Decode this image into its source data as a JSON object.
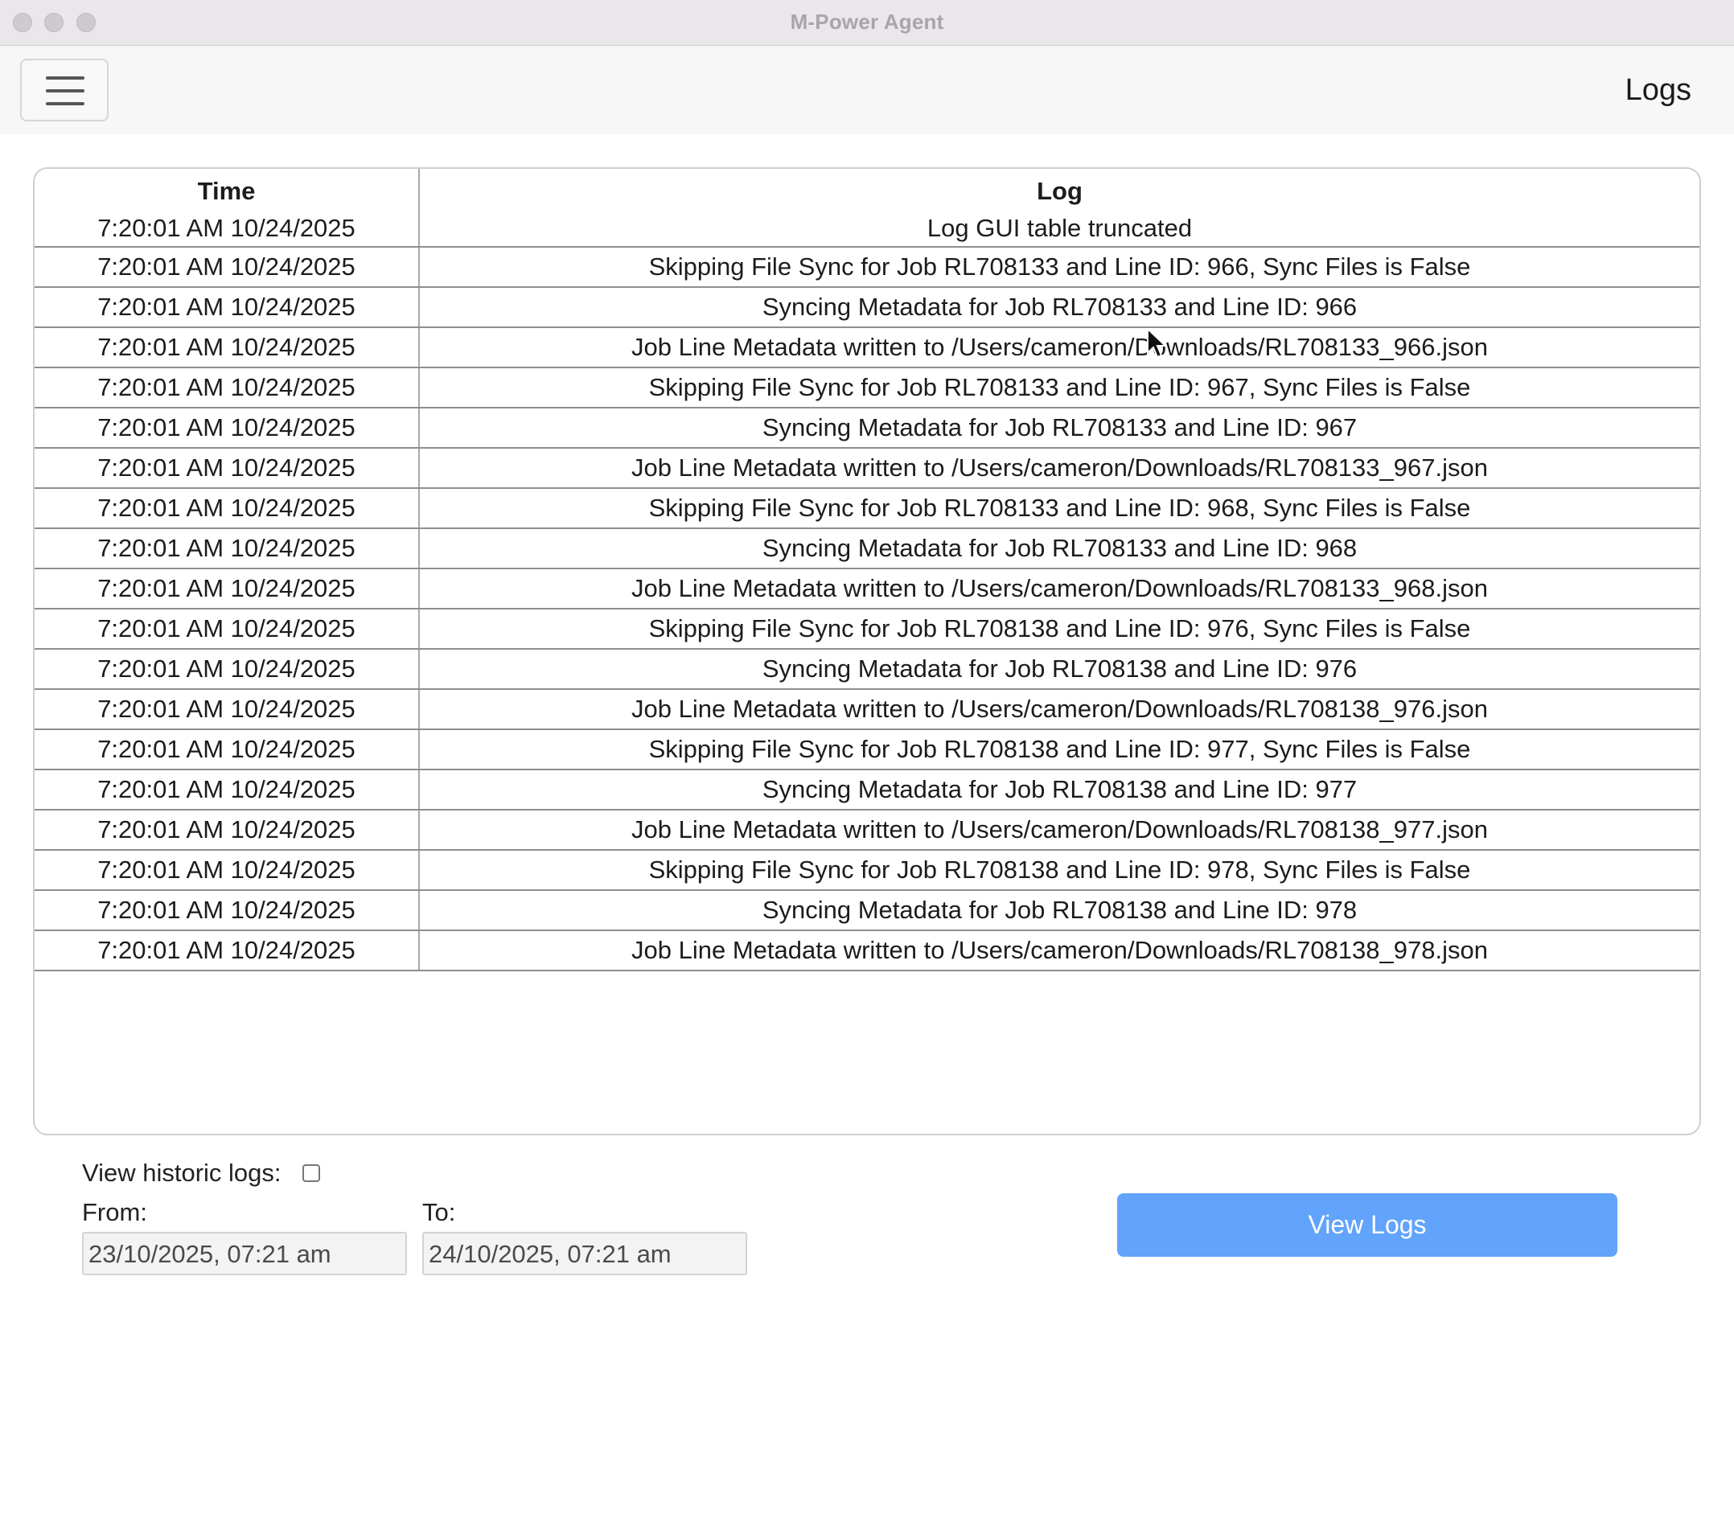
{
  "window": {
    "title": "M-Power Agent"
  },
  "header": {
    "page_title": "Logs"
  },
  "table": {
    "columns": [
      "Time",
      "Log"
    ],
    "rows": [
      {
        "time": "7:20:01 AM 10/24/2025",
        "log": "Log GUI table truncated"
      },
      {
        "time": "7:20:01 AM 10/24/2025",
        "log": "Skipping File Sync for Job RL708133 and Line ID: 966, Sync Files is False"
      },
      {
        "time": "7:20:01 AM 10/24/2025",
        "log": "Syncing Metadata for Job RL708133 and Line ID: 966"
      },
      {
        "time": "7:20:01 AM 10/24/2025",
        "log": "Job Line Metadata written to /Users/cameron/Downloads/RL708133_966.json"
      },
      {
        "time": "7:20:01 AM 10/24/2025",
        "log": "Skipping File Sync for Job RL708133 and Line ID: 967, Sync Files is False"
      },
      {
        "time": "7:20:01 AM 10/24/2025",
        "log": "Syncing Metadata for Job RL708133 and Line ID: 967"
      },
      {
        "time": "7:20:01 AM 10/24/2025",
        "log": "Job Line Metadata written to /Users/cameron/Downloads/RL708133_967.json"
      },
      {
        "time": "7:20:01 AM 10/24/2025",
        "log": "Skipping File Sync for Job RL708133 and Line ID: 968, Sync Files is False"
      },
      {
        "time": "7:20:01 AM 10/24/2025",
        "log": "Syncing Metadata for Job RL708133 and Line ID: 968"
      },
      {
        "time": "7:20:01 AM 10/24/2025",
        "log": "Job Line Metadata written to /Users/cameron/Downloads/RL708133_968.json"
      },
      {
        "time": "7:20:01 AM 10/24/2025",
        "log": "Skipping File Sync for Job RL708138 and Line ID: 976, Sync Files is False"
      },
      {
        "time": "7:20:01 AM 10/24/2025",
        "log": "Syncing Metadata for Job RL708138 and Line ID: 976"
      },
      {
        "time": "7:20:01 AM 10/24/2025",
        "log": "Job Line Metadata written to /Users/cameron/Downloads/RL708138_976.json"
      },
      {
        "time": "7:20:01 AM 10/24/2025",
        "log": "Skipping File Sync for Job RL708138 and Line ID: 977, Sync Files is False"
      },
      {
        "time": "7:20:01 AM 10/24/2025",
        "log": "Syncing Metadata for Job RL708138 and Line ID: 977"
      },
      {
        "time": "7:20:01 AM 10/24/2025",
        "log": "Job Line Metadata written to /Users/cameron/Downloads/RL708138_977.json"
      },
      {
        "time": "7:20:01 AM 10/24/2025",
        "log": "Skipping File Sync for Job RL708138 and Line ID: 978, Sync Files is False"
      },
      {
        "time": "7:20:01 AM 10/24/2025",
        "log": "Syncing Metadata for Job RL708138 and Line ID: 978"
      },
      {
        "time": "7:20:01 AM 10/24/2025",
        "log": "Job Line Metadata written to /Users/cameron/Downloads/RL708138_978.json"
      }
    ]
  },
  "historic": {
    "label": "View historic logs:",
    "checked": false,
    "from_label": "From:",
    "to_label": "To:",
    "from_value": "23/10/2025, 07:21 am",
    "to_value": "24/10/2025, 07:21 am",
    "view_button": "View Logs"
  },
  "colors": {
    "accent_button": "#62a3fb",
    "titlebar": "#e9e7e9",
    "header": "#f7f7f8"
  },
  "icons": {
    "menu": "hamburger-menu-icon",
    "cursor": "mouse-pointer-icon"
  }
}
